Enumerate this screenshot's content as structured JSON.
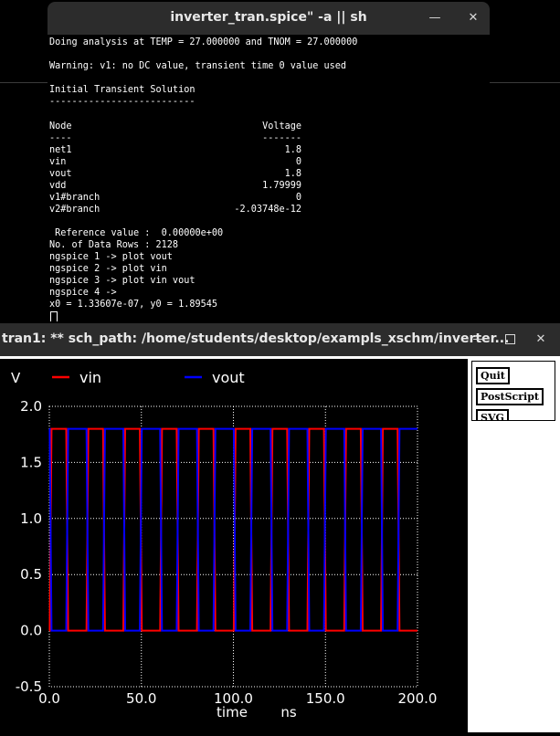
{
  "terminal": {
    "title": "inverter_tran.spice\" -a || sh",
    "lines": [
      "Doing analysis at TEMP = 27.000000 and TNOM = 27.000000",
      "",
      "Warning: v1: no DC value, transient time 0 value used",
      "",
      "Initial Transient Solution",
      "--------------------------",
      "",
      "Node",
      "----",
      "net1",
      "vin",
      "vout",
      "vdd",
      "v1#branch",
      "v2#branch",
      "",
      " Reference value :  0.00000e+00",
      "No. of Data Rows : 2128",
      "ngspice 1 -> plot vout",
      "ngspice 2 -> plot vin",
      "ngspice 3 -> plot vin vout",
      "ngspice 4 -> ",
      "x0 = 1.33607e-07, y0 = 1.89545"
    ],
    "voltage_header": "Voltage",
    "voltage_rule": "-------",
    "voltages": [
      "1.8",
      "0",
      "1.8",
      "1.79999",
      "0",
      "-2.03748e-12"
    ]
  },
  "plot_window": {
    "title": "tran1: ** sch_path: /home/students/desktop/exampls_xschm/inverter...",
    "buttons": [
      "Quit",
      "PostScript",
      "SVG"
    ]
  },
  "chart_data": {
    "type": "line",
    "ylabel": "V",
    "xlabel": "time",
    "xunit": "ns",
    "legend": [
      "vin",
      "vout"
    ],
    "legend_placement": "top",
    "colors": {
      "vin": "#ff0000",
      "vout": "#0000ff",
      "overlap": "#b000b0"
    },
    "xlim": [
      0,
      200
    ],
    "ylim": [
      -0.5,
      2.0
    ],
    "xticks": [
      "0.0",
      "50.0",
      "100.0",
      "150.0",
      "200.0"
    ],
    "yticks": [
      "-0.5",
      "0.0",
      "0.5",
      "1.0",
      "1.5",
      "2.0"
    ],
    "grid": "dotted",
    "series": [
      {
        "name": "vin",
        "high": 1.8,
        "low": 0.0,
        "period_ns": 20,
        "high_time_ns": 8,
        "edge_ns": 1
      },
      {
        "name": "vout",
        "high": 1.8,
        "low": 0.0,
        "period_ns": 20,
        "low_time_ns": 8,
        "edge_ns": 1
      }
    ]
  }
}
